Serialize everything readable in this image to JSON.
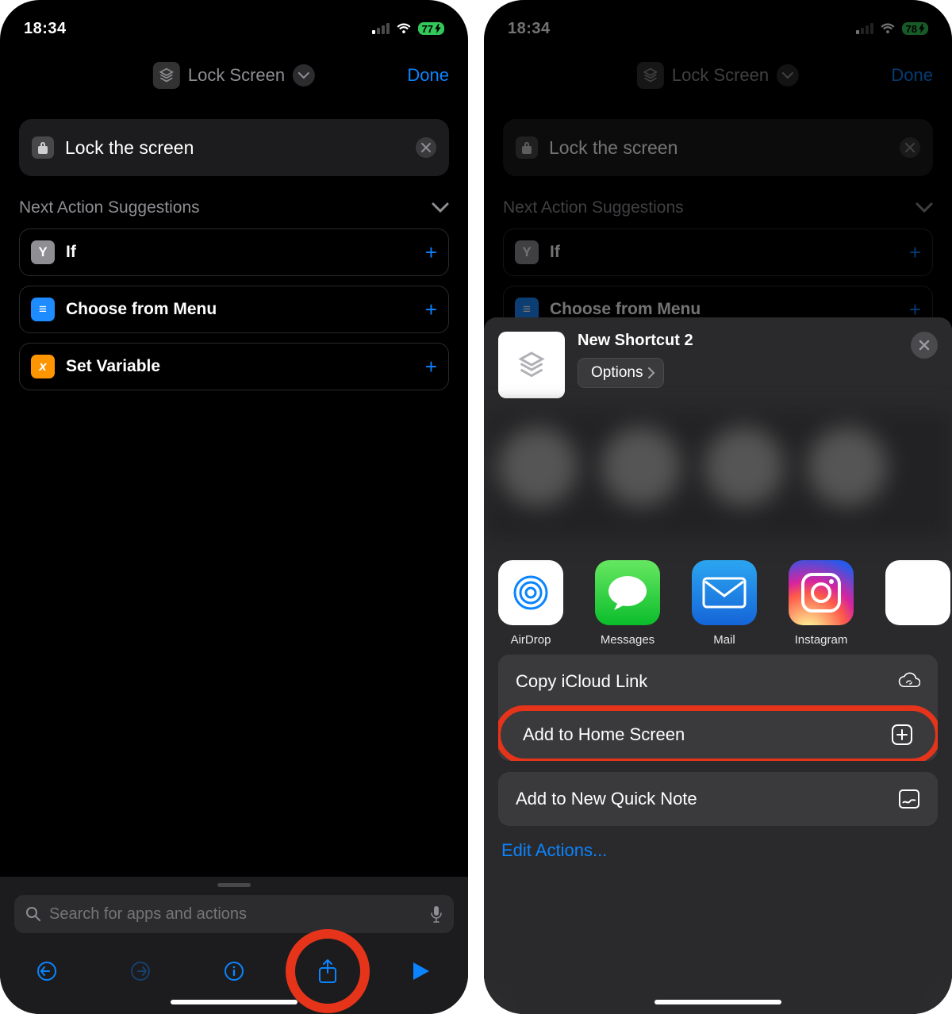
{
  "left": {
    "status": {
      "time": "18:34",
      "battery": "77"
    },
    "nav": {
      "title": "Lock Screen",
      "done": "Done"
    },
    "action": {
      "text": "Lock the screen"
    },
    "suggestions_header": "Next Action Suggestions",
    "suggestions": [
      {
        "label": "If",
        "icon": "Y",
        "bg": "#8e8e93"
      },
      {
        "label": "Choose from Menu",
        "icon": "≡",
        "bg": "#1e8bff"
      },
      {
        "label": "Set Variable",
        "icon": "x",
        "bg": "#ff9500"
      }
    ],
    "search_placeholder": "Search for apps and actions"
  },
  "right": {
    "status": {
      "time": "18:34",
      "battery": "78"
    },
    "nav": {
      "title": "Lock Screen",
      "done": "Done"
    },
    "action": {
      "text": "Lock the screen"
    },
    "suggestions_header": "Next Action Suggestions",
    "suggestions": [
      {
        "label": "If",
        "icon": "Y",
        "bg": "#8e8e93"
      },
      {
        "label": "Choose from Menu",
        "icon": "≡",
        "bg": "#1e8bff"
      }
    ],
    "sheet": {
      "title": "New Shortcut 2",
      "options_label": "Options",
      "apps": [
        {
          "label": "AirDrop",
          "cls": "airdrop"
        },
        {
          "label": "Messages",
          "cls": "messages"
        },
        {
          "label": "Mail",
          "cls": "mail"
        },
        {
          "label": "Instagram",
          "cls": "instagram"
        },
        {
          "label": "",
          "cls": "partial"
        }
      ],
      "actions_group1": [
        {
          "label": "Copy iCloud Link",
          "icon": "cloud-link"
        },
        {
          "label": "Add to Home Screen",
          "icon": "plus-square",
          "highlight": true
        }
      ],
      "actions_group2": [
        {
          "label": "Add to New Quick Note",
          "icon": "note"
        }
      ],
      "edit_label": "Edit Actions..."
    }
  }
}
